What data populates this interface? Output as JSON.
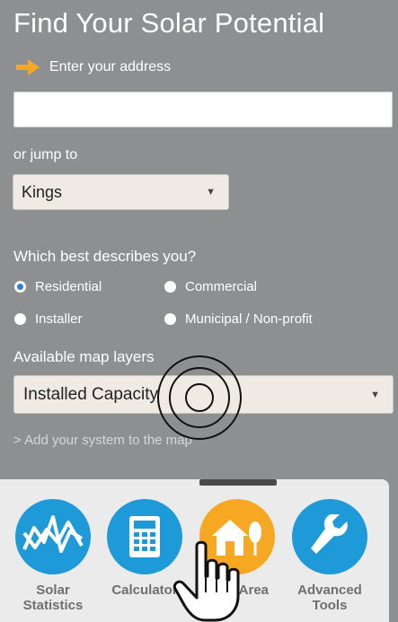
{
  "header": {
    "title": "Find Your Solar Potential"
  },
  "address": {
    "label": "Enter your address",
    "value": "",
    "placeholder": ""
  },
  "jump": {
    "label": "or jump to",
    "selected": "Kings"
  },
  "audience": {
    "question": "Which best describes you?",
    "options": [
      "Residential",
      "Commercial",
      "Installer",
      "Municipal / Non-profit"
    ],
    "selected": "Residential"
  },
  "layers": {
    "label": "Available map layers",
    "selected": "Installed Capacity"
  },
  "add_system": {
    "label": "> Add your system to the map"
  },
  "tools": [
    {
      "label_line1": "Solar",
      "label_line2": "Statistics",
      "icon": "chart-icon",
      "color": "#1e9ad8"
    },
    {
      "label_line1": "Calculator",
      "label_line2": "",
      "icon": "calculator-icon",
      "color": "#1e9ad8"
    },
    {
      "label_line1": "Your Area",
      "label_line2": "",
      "icon": "house-tree-icon",
      "color": "#f7a823"
    },
    {
      "label_line1": "Advanced",
      "label_line2": "Tools",
      "icon": "wrench-icon",
      "color": "#1e9ad8"
    }
  ],
  "colors": {
    "panel": "#8e8f91",
    "accent_orange": "#f7a823",
    "accent_blue": "#1e9ad8",
    "radio_selected": "#2f7fe0"
  }
}
